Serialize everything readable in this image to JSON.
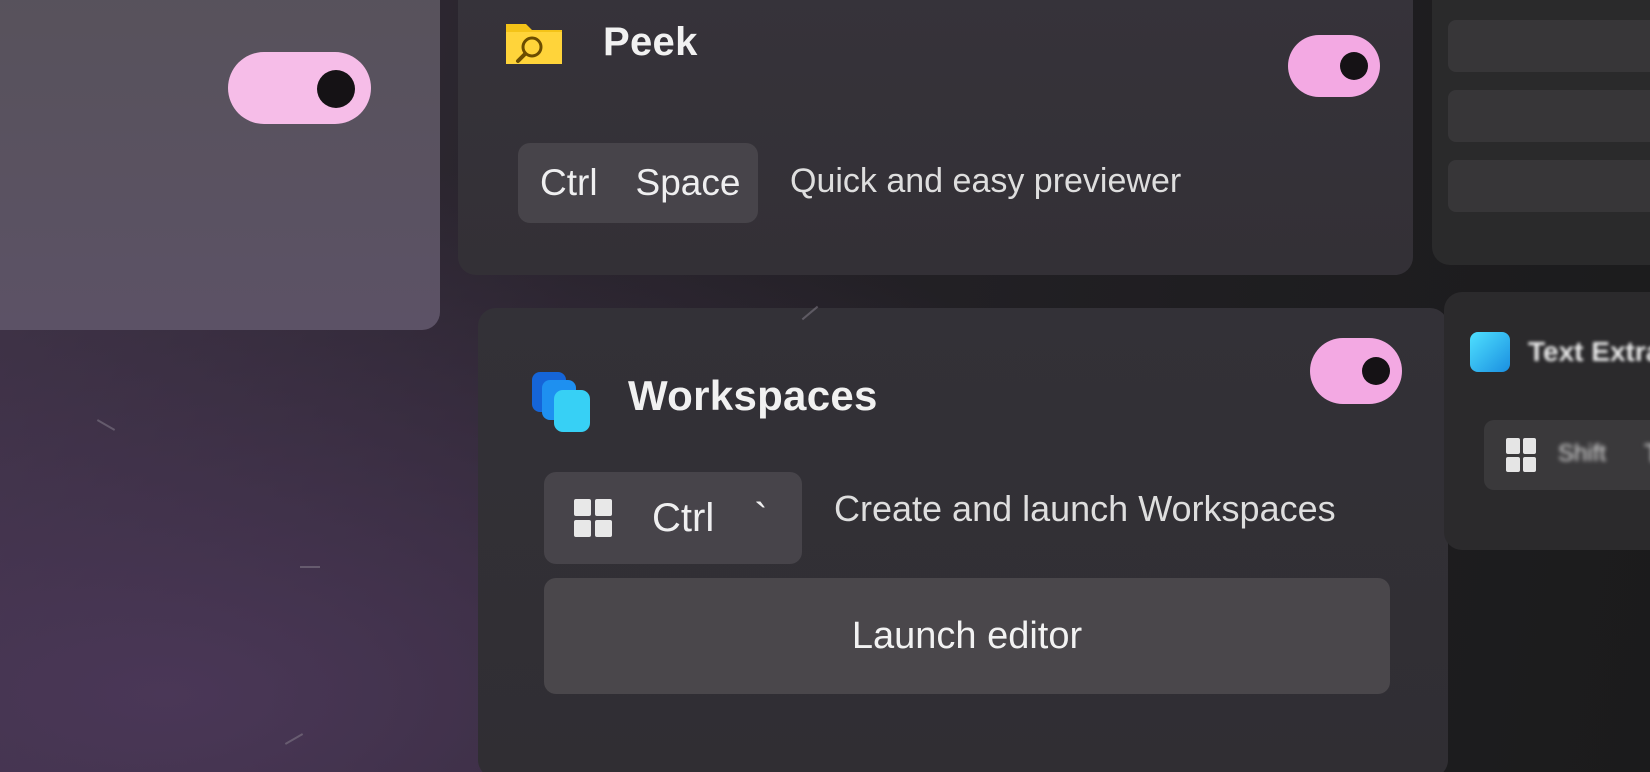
{
  "left_card": {
    "toggle_state": "on",
    "toggle_color": "#f6bde8"
  },
  "peek": {
    "icon": "folder-magnifier-icon",
    "title": "Peek",
    "toggle_state": "on",
    "toggle_color": "#f3a9e3",
    "shortcut_keys": [
      "Ctrl",
      "Space"
    ],
    "description": "Quick and easy previewer"
  },
  "workspaces": {
    "icon": "workspaces-stack-icon",
    "title": "Workspaces",
    "toggle_state": "on",
    "toggle_color": "#f3a9e3",
    "shortcut_keys": [
      "windows-logo-icon",
      "Ctrl",
      "`"
    ],
    "shortcut_labels": {
      "ctrl": "Ctrl",
      "backtick": "`"
    },
    "description": "Create and launch Workspaces",
    "launch_label": "Launch editor"
  },
  "right_card": {
    "icon": "text-extractor-icon",
    "title": "Text Extractor",
    "shortcut_labels": {
      "shift": "Shift",
      "t": "T"
    }
  }
}
